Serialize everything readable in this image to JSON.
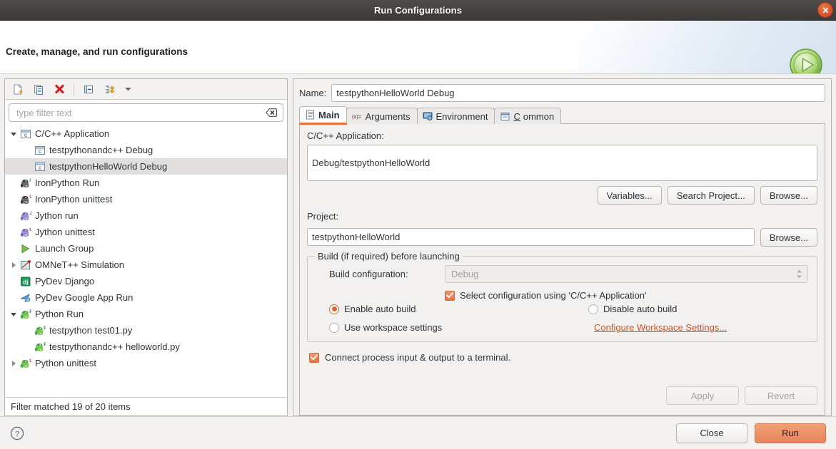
{
  "window": {
    "title": "Run Configurations",
    "close_icon": "close-icon"
  },
  "banner": {
    "title": "Create, manage, and run configurations",
    "icon": "run-play-icon"
  },
  "left_pane": {
    "toolbar": [
      {
        "name": "new-configuration-button",
        "icon": "new-document-icon"
      },
      {
        "name": "duplicate-configuration-button",
        "icon": "copy-icon"
      },
      {
        "name": "delete-configuration-button",
        "icon": "delete-x-icon"
      },
      {
        "name": "collapse-all-button",
        "icon": "collapse-all-icon"
      },
      {
        "name": "filter-launch-button",
        "icon": "filter-arrow-icon"
      },
      {
        "name": "view-menu-button",
        "icon": "chevron-down-icon"
      }
    ],
    "filter": {
      "placeholder": "type filter text",
      "value": "",
      "clear_icon": "clear-field-icon"
    },
    "tree": [
      {
        "label": "C/C++ Application",
        "icon": "cpp-application-icon",
        "level": 1,
        "twisty": "expanded",
        "selected": false
      },
      {
        "label": "testpythonandc++ Debug",
        "icon": "cpp-application-icon",
        "level": 2,
        "twisty": "none",
        "selected": false
      },
      {
        "label": "testpythonHelloWorld Debug",
        "icon": "cpp-application-icon",
        "level": 2,
        "twisty": "none",
        "selected": true
      },
      {
        "label": "IronPython Run",
        "icon": "ironpython-run-icon",
        "level": 1,
        "twisty": "none",
        "selected": false
      },
      {
        "label": "IronPython unittest",
        "icon": "ironpython-unittest-icon",
        "level": 1,
        "twisty": "none",
        "selected": false
      },
      {
        "label": "Jython run",
        "icon": "jython-run-icon",
        "level": 1,
        "twisty": "none",
        "selected": false
      },
      {
        "label": "Jython unittest",
        "icon": "jython-unittest-icon",
        "level": 1,
        "twisty": "none",
        "selected": false
      },
      {
        "label": "Launch Group",
        "icon": "launch-group-icon",
        "level": 1,
        "twisty": "none",
        "selected": false
      },
      {
        "label": "OMNeT++ Simulation",
        "icon": "omnetpp-simulation-icon",
        "level": 1,
        "twisty": "collapsed",
        "selected": false
      },
      {
        "label": "PyDev Django",
        "icon": "pydev-django-icon",
        "level": 1,
        "twisty": "none",
        "selected": false
      },
      {
        "label": "PyDev Google App Run",
        "icon": "pydev-google-app-icon",
        "level": 1,
        "twisty": "none",
        "selected": false
      },
      {
        "label": "Python Run",
        "icon": "python-run-icon",
        "level": 1,
        "twisty": "expanded",
        "selected": false
      },
      {
        "label": "testpython test01.py",
        "icon": "python-run-icon",
        "level": 2,
        "twisty": "none",
        "selected": false
      },
      {
        "label": "testpythonandc++ helloworld.py",
        "icon": "python-run-icon",
        "level": 2,
        "twisty": "none",
        "selected": false
      },
      {
        "label": "Python unittest",
        "icon": "python-unittest-icon",
        "level": 1,
        "twisty": "collapsed",
        "selected": false
      }
    ],
    "status": "Filter matched 19 of 20 items"
  },
  "right_pane": {
    "name_label": "Name:",
    "name_value": "testpythonHelloWorld Debug",
    "tabs": [
      {
        "label": "Main",
        "icon": "document-icon",
        "active": true
      },
      {
        "label": "Arguments",
        "icon": "variables-icon",
        "active": false
      },
      {
        "label": "Environment",
        "icon": "environment-icon",
        "active": false
      },
      {
        "label": "Common",
        "icon": "common-icon",
        "active": false,
        "mnemonic": "C"
      }
    ],
    "application": {
      "label": "C/C++ Application:",
      "value": "Debug/testpythonHelloWorld",
      "buttons": [
        "Variables...",
        "Search Project...",
        "Browse..."
      ]
    },
    "project": {
      "label": "Project:",
      "value": "testpythonHelloWorld",
      "browse_label": "Browse..."
    },
    "build_group": {
      "title": "Build (if required) before launching",
      "build_config_label": "Build configuration:",
      "build_config_value": "Debug",
      "build_config_enabled": false,
      "select_config_checkbox": {
        "label": "Select configuration using 'C/C++ Application'",
        "checked": true
      },
      "radios": [
        {
          "label": "Enable auto build",
          "checked": true
        },
        {
          "label": "Disable auto build",
          "checked": false
        },
        {
          "label": "Use workspace settings",
          "checked": false
        }
      ],
      "configure_link": "Configure Workspace Settings..."
    },
    "terminal_checkbox": {
      "label": "Connect process input & output to a terminal.",
      "checked": true
    },
    "apply_label": "Apply",
    "apply_enabled": false,
    "revert_label": "Revert",
    "revert_enabled": false
  },
  "footer": {
    "help_icon": "help-question-icon",
    "close_label": "Close",
    "run_label": "Run"
  },
  "colors": {
    "accent_orange": "#e8703a",
    "link_orange": "#d4511f",
    "titlebar": "#3c3936",
    "selection": "#e2e0de"
  }
}
